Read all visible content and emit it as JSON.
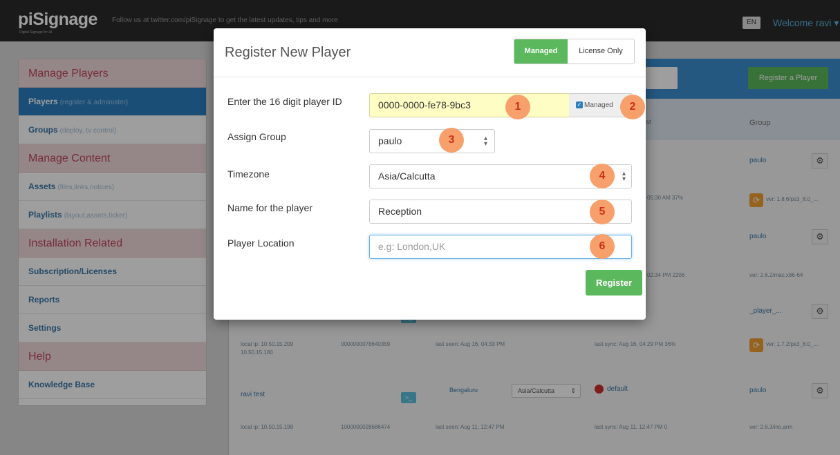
{
  "app": {
    "logo": "piSignage",
    "logo_sub": "Digital Signage for all",
    "tagline": "Follow us at twitter.com/piSignage to get the latest updates, tips and more",
    "lang": "EN",
    "welcome": "Welcome ravi ▾"
  },
  "sidebar": {
    "sections": [
      {
        "heading": "Manage Players",
        "items": [
          {
            "label": "Players",
            "hint": "(register & administer)"
          },
          {
            "label": "Groups",
            "hint": "(deploy, tv control)"
          }
        ]
      },
      {
        "heading": "Manage Content",
        "items": [
          {
            "label": "Assets",
            "hint": "(files,links,notices)"
          },
          {
            "label": "Playlists",
            "hint": "(layout,assets,ticker)"
          }
        ]
      },
      {
        "heading": "Installation Related",
        "items": [
          {
            "label": "Subscription/Licenses",
            "hint": ""
          },
          {
            "label": "Reports",
            "hint": ""
          },
          {
            "label": "Settings",
            "hint": ""
          }
        ]
      },
      {
        "heading": "Help",
        "items": [
          {
            "label": "Knowledge Base",
            "hint": ""
          }
        ]
      }
    ]
  },
  "background": {
    "register_player_button": "Register a Player",
    "col_last_sync": "st",
    "col_group": "Group",
    "rows": [
      {
        "group": "paulo",
        "sync": "05:30 AM 37%",
        "version": "ver: 1.8.6/ps3_8.0_..."
      },
      {
        "group": "paulo",
        "sync": "02:34 PM 2206",
        "version": "ver: 2.6.2/mac,x86-64"
      },
      {
        "group": "_player_...",
        "local_ip": "local ip: 10.50.15.209",
        "local_ip2": "10.50.15.180",
        "id": "0000000078640359",
        "last_seen": "last seen: Aug 16, 04:33 PM",
        "sync": "last sync: Aug 16, 04:29 PM 36%",
        "version": "ver: 1.7.2/ps3_8.0_..."
      },
      {
        "name": "ravi test",
        "location": "Bengaluru",
        "tz": "Asia/Calcutta",
        "playlist": "default",
        "group": "paulo",
        "local_ip": "local ip: 10.50.15.198",
        "id": "1000000028686474",
        "last_seen": "last seen: Aug 11, 12:47 PM",
        "sync": "last sync: Aug 11, 12:47 PM 0",
        "version": "ver: 2.6.3/ino,arm"
      }
    ]
  },
  "modal": {
    "title": "Register New Player",
    "toggle_on": "Managed",
    "toggle_off": "License Only",
    "fields": {
      "player_id": {
        "label": "Enter the 16 digit player ID",
        "value": "0000-0000-fe78-9bc3",
        "addon": "Managed"
      },
      "group": {
        "label": "Assign Group",
        "value": "paulo"
      },
      "timezone": {
        "label": "Timezone",
        "value": "Asia/Calcutta"
      },
      "name": {
        "label": "Name for the player",
        "value": "Reception"
      },
      "location": {
        "label": "Player Location",
        "placeholder": "e.g: London,UK"
      }
    },
    "register_button": "Register",
    "badges": [
      "1",
      "2",
      "3",
      "4",
      "5",
      "6"
    ]
  },
  "colors": {
    "accent_green": "#5cb85c",
    "accent_blue": "#2a7fbf",
    "badge": "#f7a06b",
    "section_heading": "#c0465f"
  }
}
